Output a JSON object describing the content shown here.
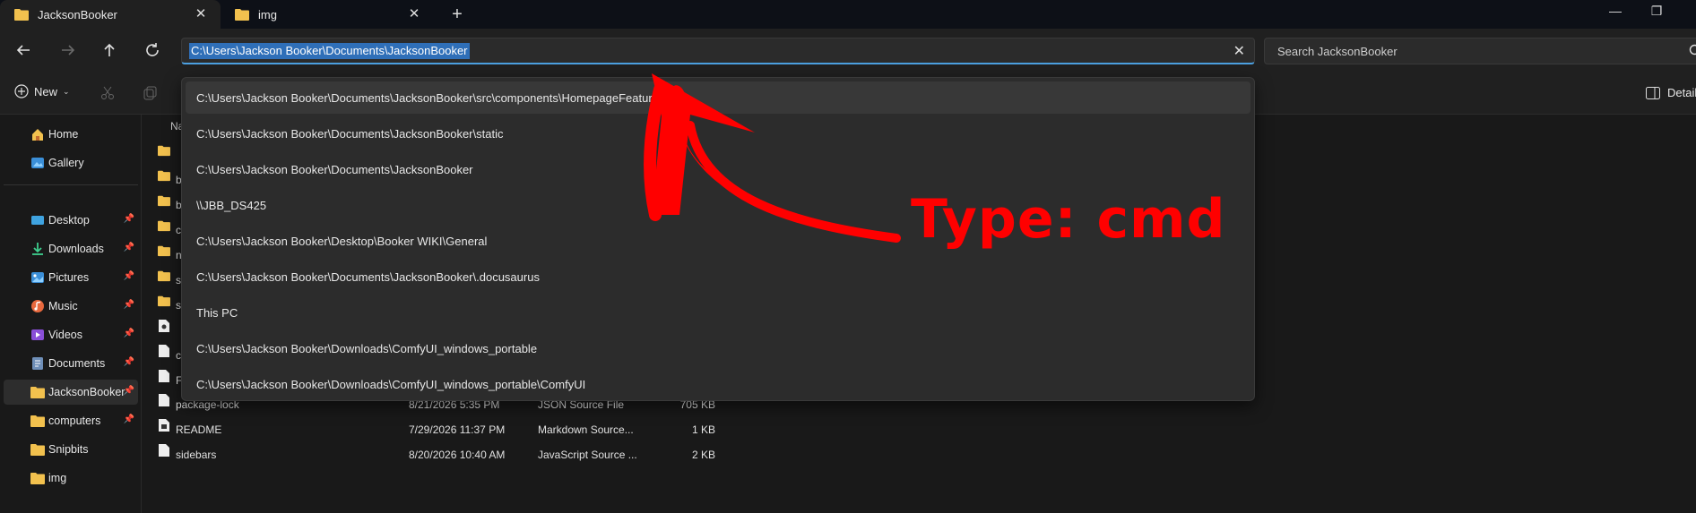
{
  "tabs": [
    {
      "label": "JacksonBooker",
      "active": true
    },
    {
      "label": "img",
      "active": false
    }
  ],
  "address": {
    "value": "C:\\Users\\Jackson Booker\\Documents\\JacksonBooker"
  },
  "search": {
    "placeholder": "Search JacksonBooker"
  },
  "toolbar": {
    "new_label": "New",
    "details_label": "Detail"
  },
  "sidebar": {
    "items": [
      {
        "label": "Home",
        "icon": "home-icon",
        "pinned": false
      },
      {
        "label": "Gallery",
        "icon": "gallery-icon",
        "pinned": false
      },
      {
        "label": "Desktop",
        "icon": "desktop-icon",
        "pinned": true
      },
      {
        "label": "Downloads",
        "icon": "download-icon",
        "pinned": true
      },
      {
        "label": "Pictures",
        "icon": "pictures-icon",
        "pinned": true
      },
      {
        "label": "Music",
        "icon": "music-icon",
        "pinned": true
      },
      {
        "label": "Videos",
        "icon": "videos-icon",
        "pinned": true
      },
      {
        "label": "Documents",
        "icon": "documents-icon",
        "pinned": true
      },
      {
        "label": "JacksonBooker",
        "icon": "folder-icon",
        "pinned": true
      },
      {
        "label": "computers",
        "icon": "folder-icon",
        "pinned": true
      },
      {
        "label": "Snipbits",
        "icon": "folder-icon",
        "pinned": false
      },
      {
        "label": "img",
        "icon": "folder-icon",
        "pinned": false
      }
    ]
  },
  "filelist": {
    "column_name": "Na",
    "partial_rows": [
      "",
      "b",
      "b",
      "c",
      "n",
      "s",
      "s",
      "",
      "c",
      "F"
    ],
    "rows": [
      {
        "name": "package-lock",
        "date": "8/21/2026 5:35 PM",
        "type": "JSON Source File",
        "size": "705 KB"
      },
      {
        "name": "README",
        "date": "7/29/2026 11:37 PM",
        "type": "Markdown Source...",
        "size": "1 KB"
      },
      {
        "name": "sidebars",
        "date": "8/20/2026 10:40 AM",
        "type": "JavaScript Source ...",
        "size": "2 KB"
      }
    ]
  },
  "dropdown": {
    "items": [
      "C:\\Users\\Jackson Booker\\Documents\\JacksonBooker\\src\\components\\HomepageFeatures",
      "C:\\Users\\Jackson Booker\\Documents\\JacksonBooker\\static",
      "C:\\Users\\Jackson Booker\\Documents\\JacksonBooker",
      "\\\\JBB_DS425",
      "C:\\Users\\Jackson Booker\\Desktop\\Booker WIKI\\General",
      "C:\\Users\\Jackson Booker\\Documents\\JacksonBooker\\.docusaurus",
      "This PC",
      "C:\\Users\\Jackson Booker\\Downloads\\ComfyUI_windows_portable",
      "C:\\Users\\Jackson Booker\\Downloads\\ComfyUI_windows_portable\\ComfyUI"
    ]
  },
  "annotation": {
    "text": "Type: cmd",
    "color": "#ff0000"
  },
  "colors": {
    "accent": "#4ca0e0",
    "folder": "#f2c14e",
    "selection": "#2f6fb8"
  }
}
